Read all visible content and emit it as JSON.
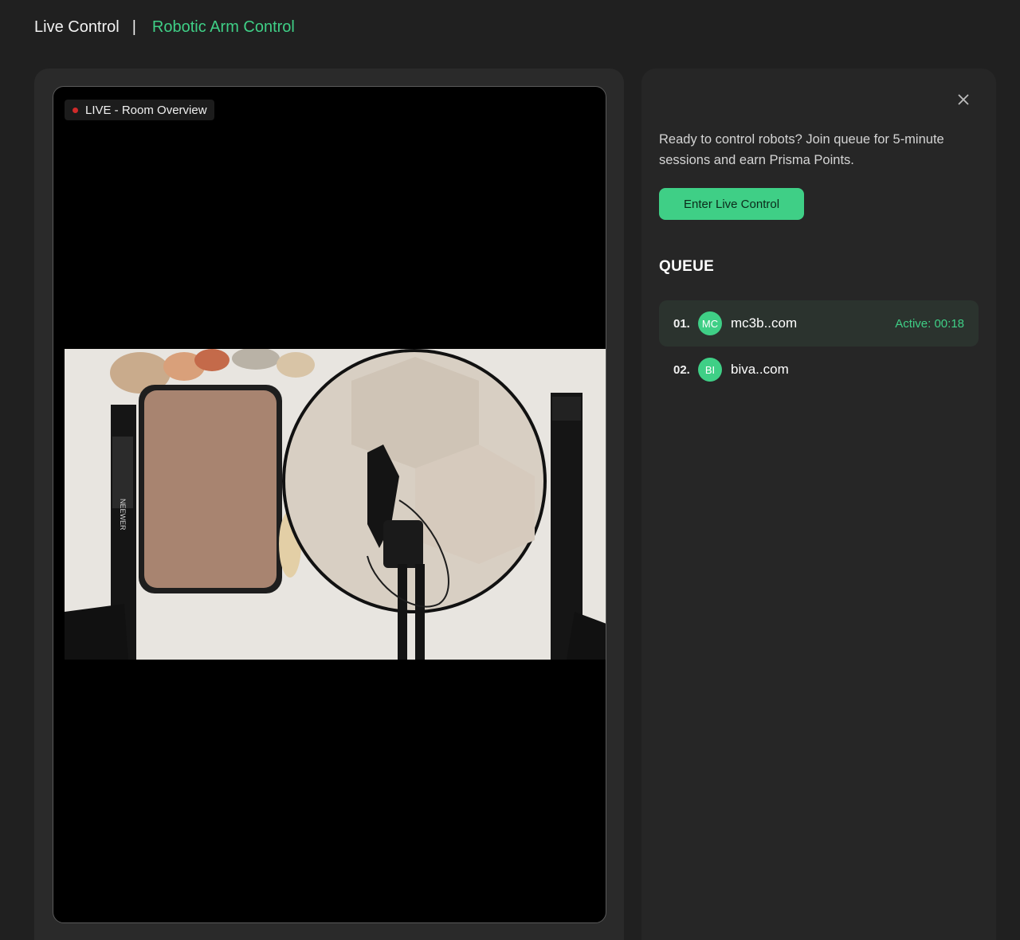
{
  "header": {
    "title": "Live Control",
    "separator": "|",
    "subtitle": "Robotic Arm Control"
  },
  "video": {
    "badge": "LIVE - Room Overview",
    "camera_label": "NEEWER"
  },
  "panel": {
    "intro": "Ready to control robots? Join queue for 5-minute sessions and earn Prisma Points.",
    "enter_button": "Enter Live Control",
    "queue_title": "QUEUE",
    "queue": [
      {
        "num": "01.",
        "initials": "MC",
        "name": "mc3b..com",
        "status": "Active: 00:18"
      },
      {
        "num": "02.",
        "initials": "BI",
        "name": "biva..com",
        "status": ""
      }
    ]
  },
  "colors": {
    "accent": "#3fcf86",
    "background": "#202020",
    "panel": "#262626",
    "live_dot": "#d02a2a"
  },
  "icons": {
    "close": "close-icon",
    "live": "live-dot-icon"
  }
}
